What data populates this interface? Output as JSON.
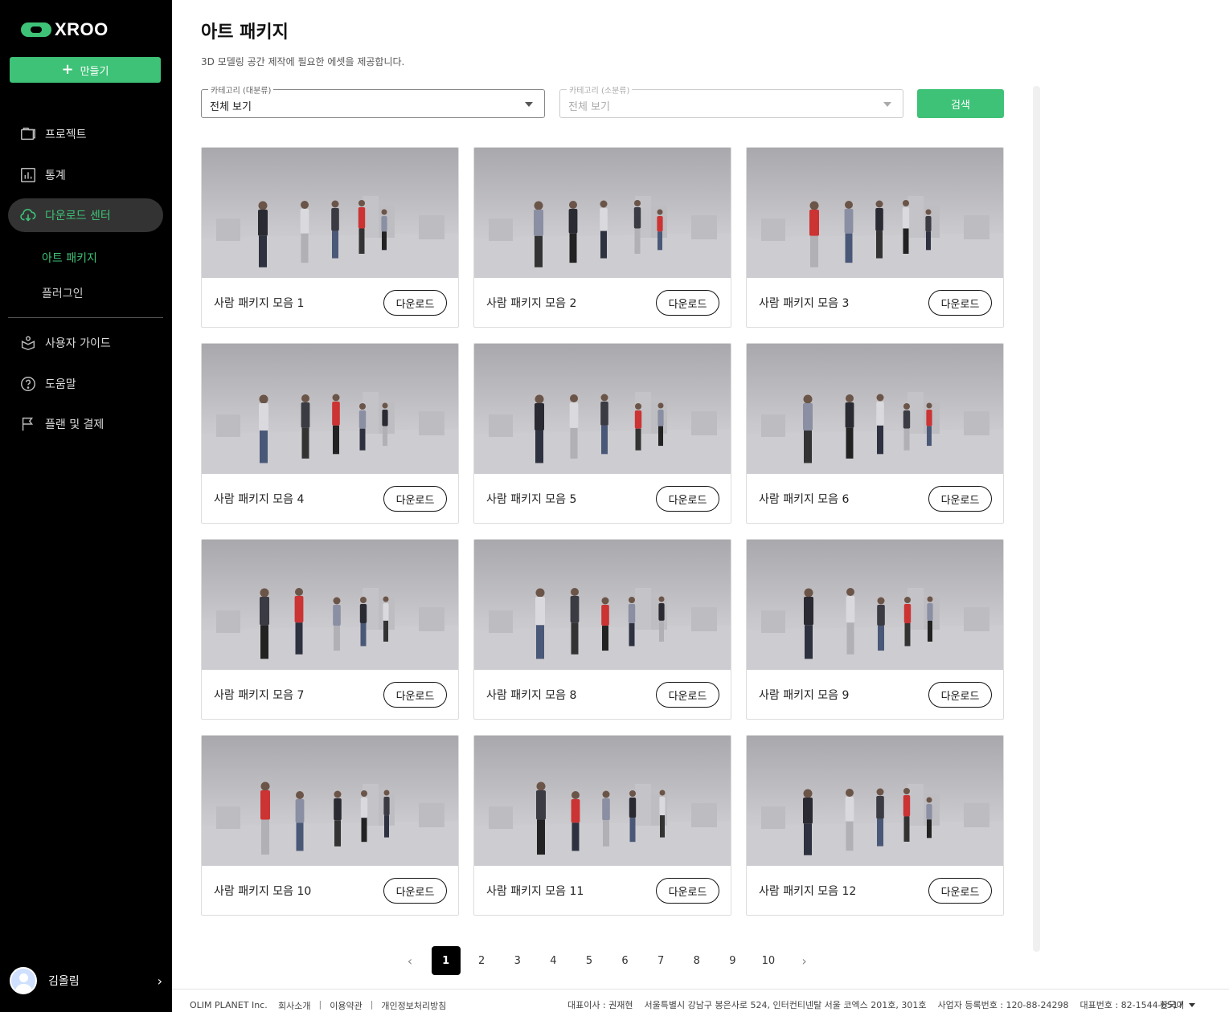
{
  "brand": {
    "name": "XROO",
    "accent": "#3ec277"
  },
  "sidebar": {
    "create_label": "만들기",
    "nav": [
      {
        "label": "프로젝트",
        "icon": "folder-icon"
      },
      {
        "label": "통계",
        "icon": "chart-icon"
      },
      {
        "label": "다운로드 센터",
        "icon": "cloud-download-icon",
        "active": true
      },
      {
        "label": "사용자 가이드",
        "icon": "guide-icon"
      },
      {
        "label": "도움말",
        "icon": "help-icon"
      },
      {
        "label": "플랜 및 결제",
        "icon": "flag-icon"
      }
    ],
    "sub": [
      {
        "label": "아트 패키지",
        "active": true
      },
      {
        "label": "플러그인"
      }
    ],
    "user_name": "김올림"
  },
  "main": {
    "title": "아트 패키지",
    "description": "3D 모델링 공간 제작에 필요한 에셋을 제공합니다.",
    "filter_major": {
      "label": "카테고리 (대분류)",
      "value": "전체 보기"
    },
    "filter_minor": {
      "label": "카테고리 (소분류)",
      "value": "전체 보기"
    },
    "search_label": "검색",
    "download_label": "다운로드",
    "cards": [
      "사람 패키지 모음 1",
      "사람 패키지 모음 2",
      "사람 패키지 모음 3",
      "사람 패키지 모음 4",
      "사람 패키지 모음 5",
      "사람 패키지 모음 6",
      "사람 패키지 모음 7",
      "사람 패키지 모음 8",
      "사람 패키지 모음 9",
      "사람 패키지 모음 10",
      "사람 패키지 모음 11",
      "사람 패키지 모음 12"
    ],
    "pages": [
      "1",
      "2",
      "3",
      "4",
      "5",
      "6",
      "7",
      "8",
      "9",
      "10"
    ],
    "current_page": "1"
  },
  "footer": {
    "corp": "OLIM PLANET Inc.",
    "links": [
      "회사소개",
      "이용약관",
      "개인정보처리방침"
    ],
    "info": [
      "대표이사 : 권재현",
      "서울특별시 강남구 봉은사로 524, 인터컨티넨탈 서울 코엑스 201호, 301호",
      "사업자 등록번호 : 120-88-24298",
      "대표번호 : 82-1544-6517"
    ],
    "language": "한국어"
  }
}
